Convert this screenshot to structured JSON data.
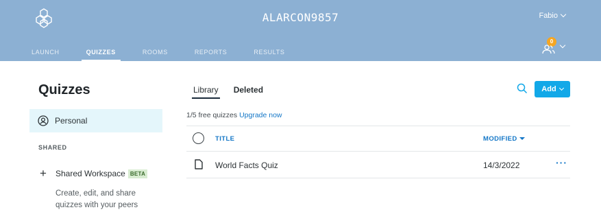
{
  "header": {
    "room_name": "ALARCON9857",
    "user_name": "Fabio",
    "notification_count": "0",
    "nav": [
      {
        "label": "LAUNCH"
      },
      {
        "label": "QUIZZES",
        "active": true
      },
      {
        "label": "ROOMS"
      },
      {
        "label": "REPORTS"
      },
      {
        "label": "RESULTS"
      }
    ]
  },
  "sidebar": {
    "title": "Quizzes",
    "personal_label": "Personal",
    "shared_heading": "SHARED",
    "shared_workspace_label": "Shared Workspace",
    "beta_badge": "BETA",
    "shared_description": "Create, edit, and share quizzes with your peers"
  },
  "main": {
    "tabs": [
      {
        "label": "Library",
        "active": true
      },
      {
        "label": "Deleted"
      }
    ],
    "add_label": "Add",
    "quota_text": "1/5 free quizzes",
    "upgrade_link": "Upgrade now",
    "table": {
      "col_title": "TITLE",
      "col_modified": "MODIFIED",
      "rows": [
        {
          "title": "World Facts Quiz",
          "modified": "14/3/2022",
          "more": "···"
        }
      ]
    }
  },
  "icons": {
    "logo": "hexagon-logo-icon",
    "personal": "user-circle-icon",
    "search": "search-icon",
    "document": "document-icon",
    "notifications": "users-icon"
  },
  "colors": {
    "header_bg": "#8cb0d3",
    "accent": "#12a8e8",
    "link": "#1477c7",
    "badge": "#f5a623",
    "sidebar_active_bg": "#e4f6fb"
  }
}
